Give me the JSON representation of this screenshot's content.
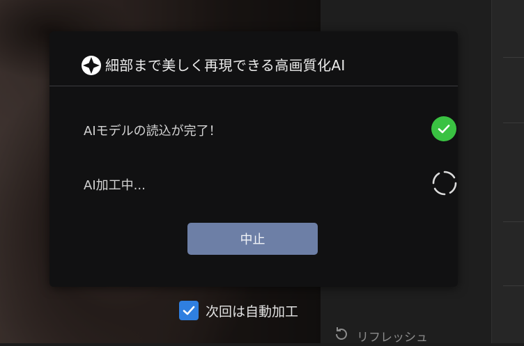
{
  "dialog": {
    "title": "細部まで美しく再現できる高画質化AI",
    "steps": [
      {
        "label": "AIモデルの読込が完了！",
        "state": "done",
        "icon": "check-circle-icon"
      },
      {
        "label": "AI加工中...",
        "state": "in-progress",
        "icon": "spinner-icon"
      }
    ],
    "stop_label": "中止"
  },
  "auto_process": {
    "label": "次回は自動加工",
    "checked": true
  },
  "side_panel": {
    "refresh_label": "リフレッシュ"
  },
  "colors": {
    "accent_button": "#6d7fa6",
    "success": "#3ac242",
    "checkbox": "#2f7fe0",
    "modal_bg": "#111112"
  }
}
